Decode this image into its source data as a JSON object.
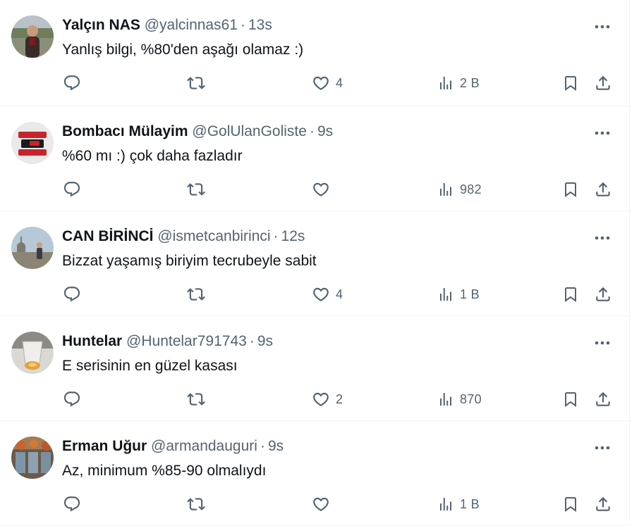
{
  "replies": [
    {
      "name": "Yalçın NAS",
      "handle": "@yalcinnas61",
      "separator": "·",
      "time": "13s",
      "text": "Yanlış bilgi, %80'den aşağı olamaz :)",
      "likes": "4",
      "views": "2 B",
      "avatar_icon": "user-avatar-photo"
    },
    {
      "name": "Bombacı Mülayim",
      "handle": "@GolUlanGoliste",
      "separator": "·",
      "time": "9s",
      "text": "%60 mı :) çok daha fazladır",
      "likes": "",
      "views": "982",
      "avatar_icon": "user-avatar-logo"
    },
    {
      "name": "CAN BİRİNCİ",
      "handle": "@ismetcanbirinci",
      "separator": "·",
      "time": "12s",
      "text": "Bizzat yaşamış biriyim tecrubeyle sabit",
      "likes": "4",
      "views": "1 B",
      "avatar_icon": "user-avatar-photo"
    },
    {
      "name": "Huntelar",
      "handle": "@Huntelar791743",
      "separator": "·",
      "time": "9s",
      "text": "E serisinin en güzel kasası",
      "likes": "2",
      "views": "870",
      "avatar_icon": "user-avatar-photo"
    },
    {
      "name": "Erman Uğur",
      "handle": "@armandauguri",
      "separator": "·",
      "time": "9s",
      "text": "Az, minimum %85-90 olmalıydı",
      "likes": "",
      "views": "1 B",
      "avatar_icon": "user-avatar-photo"
    }
  ],
  "icons": {
    "more": "more-dots-icon",
    "reply": "reply-bubble-icon",
    "repost": "repost-arrows-icon",
    "like": "heart-icon",
    "views": "bar-chart-icon",
    "bookmark": "bookmark-icon",
    "share": "share-upload-icon"
  },
  "colors": {
    "text": "#0f1419",
    "secondary": "#536471",
    "divider": "#eff3f4",
    "logo_red": "#c8232c"
  }
}
